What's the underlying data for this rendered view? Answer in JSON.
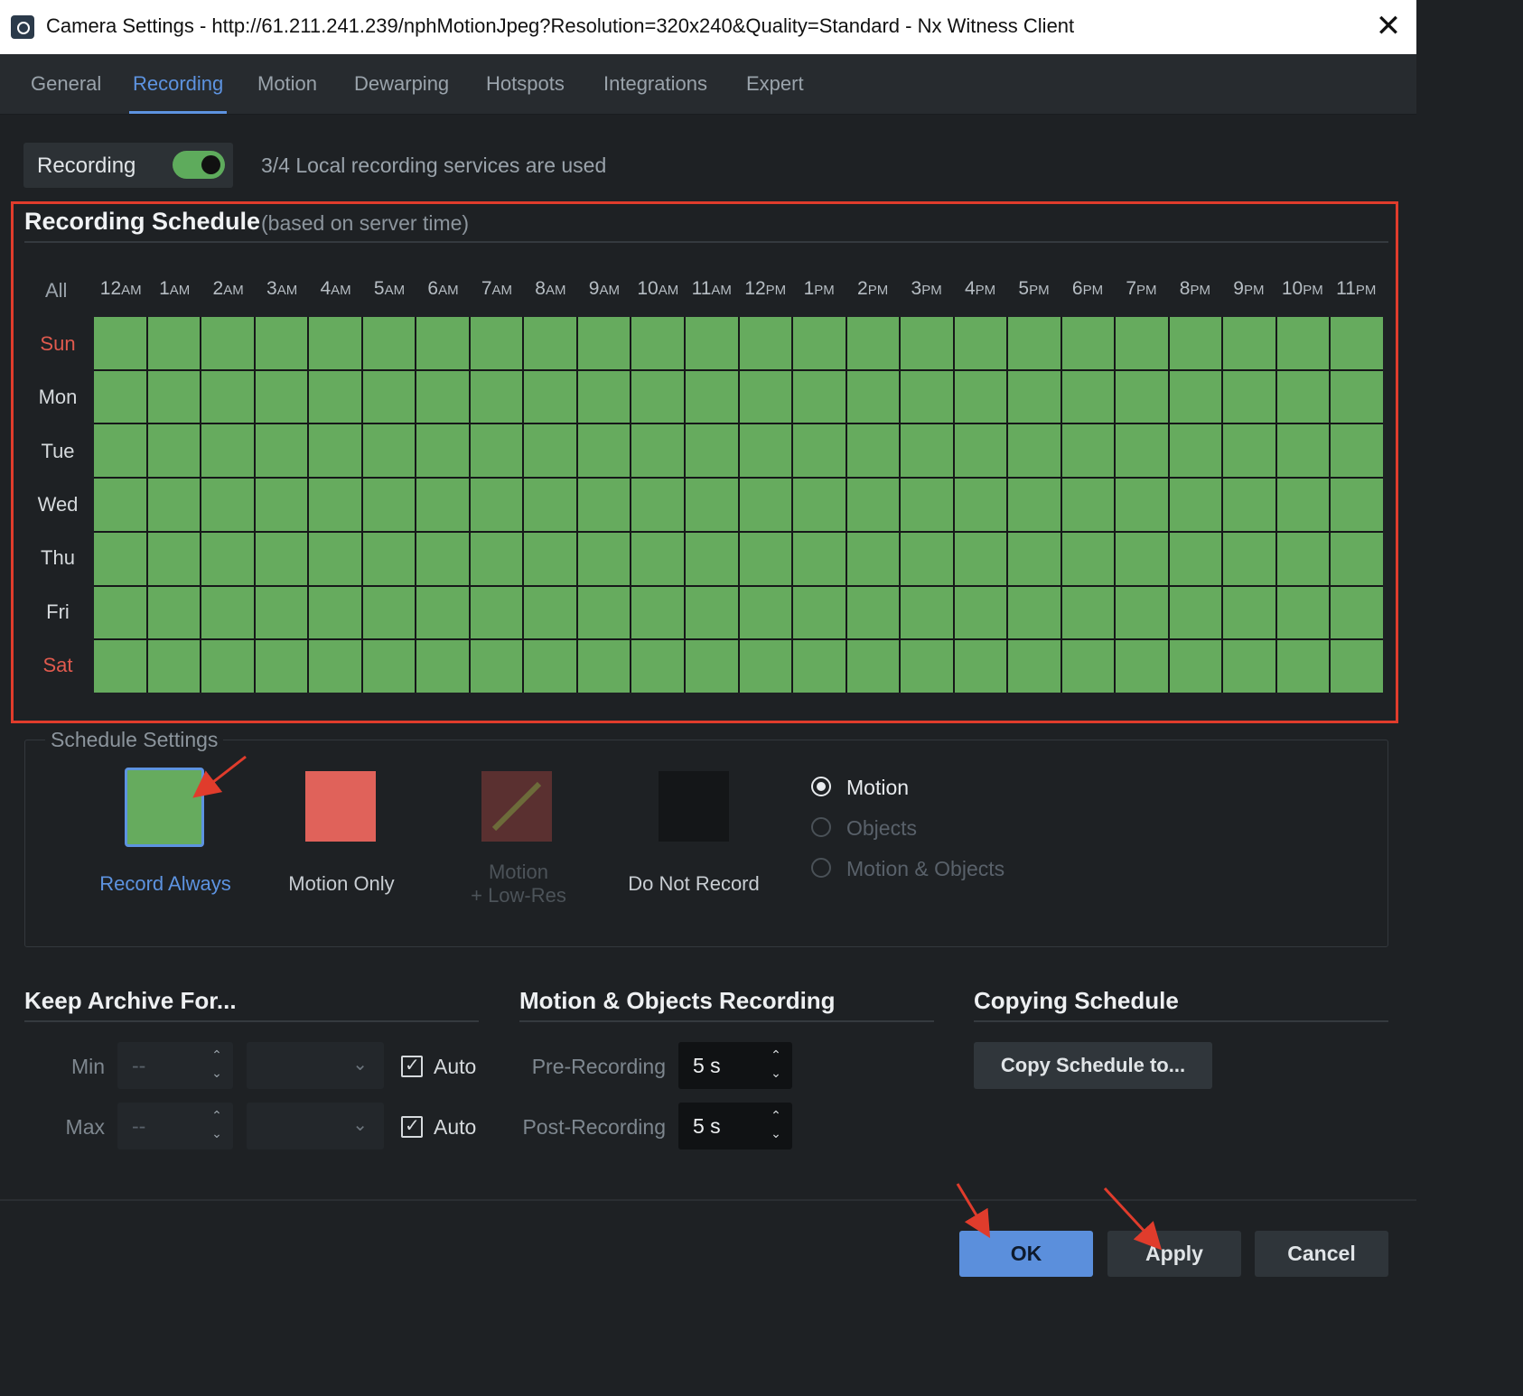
{
  "window": {
    "title": "Camera Settings - http://61.211.241.239/nphMotionJpeg?Resolution=320x240&Quality=Standard - Nx Witness Client",
    "close_glyph": "✕"
  },
  "tabs": [
    {
      "label": "General",
      "active": false
    },
    {
      "label": "Recording",
      "active": true
    },
    {
      "label": "Motion",
      "active": false
    },
    {
      "label": "Dewarping",
      "active": false
    },
    {
      "label": "Hotspots",
      "active": false
    },
    {
      "label": "Integrations",
      "active": false
    },
    {
      "label": "Expert",
      "active": false
    }
  ],
  "recording": {
    "label": "Recording",
    "enabled": true,
    "status": "3/4 Local recording services are used"
  },
  "schedule": {
    "title": "Recording Schedule",
    "subtitle": "(based on server time)",
    "all_label": "All",
    "hours": [
      {
        "n": "12",
        "s": "AM"
      },
      {
        "n": "1",
        "s": "AM"
      },
      {
        "n": "2",
        "s": "AM"
      },
      {
        "n": "3",
        "s": "AM"
      },
      {
        "n": "4",
        "s": "AM"
      },
      {
        "n": "5",
        "s": "AM"
      },
      {
        "n": "6",
        "s": "AM"
      },
      {
        "n": "7",
        "s": "AM"
      },
      {
        "n": "8",
        "s": "AM"
      },
      {
        "n": "9",
        "s": "AM"
      },
      {
        "n": "10",
        "s": "AM"
      },
      {
        "n": "11",
        "s": "AM"
      },
      {
        "n": "12",
        "s": "PM"
      },
      {
        "n": "1",
        "s": "PM"
      },
      {
        "n": "2",
        "s": "PM"
      },
      {
        "n": "3",
        "s": "PM"
      },
      {
        "n": "4",
        "s": "PM"
      },
      {
        "n": "5",
        "s": "PM"
      },
      {
        "n": "6",
        "s": "PM"
      },
      {
        "n": "7",
        "s": "PM"
      },
      {
        "n": "8",
        "s": "PM"
      },
      {
        "n": "9",
        "s": "PM"
      },
      {
        "n": "10",
        "s": "PM"
      },
      {
        "n": "11",
        "s": "PM"
      }
    ],
    "days": [
      {
        "label": "Sun",
        "weekend": true
      },
      {
        "label": "Mon",
        "weekend": false
      },
      {
        "label": "Tue",
        "weekend": false
      },
      {
        "label": "Wed",
        "weekend": false
      },
      {
        "label": "Thu",
        "weekend": false
      },
      {
        "label": "Fri",
        "weekend": false
      },
      {
        "label": "Sat",
        "weekend": true
      }
    ],
    "cell_mode": "record-always"
  },
  "schedule_settings": {
    "title": "Schedule Settings",
    "modes": {
      "record_always": "Record Always",
      "motion_only": "Motion Only",
      "motion_lowres_line1": "Motion",
      "motion_lowres_line2": "+ Low-Res",
      "do_not_record": "Do Not Record"
    },
    "selected_mode": "record_always",
    "trigger": {
      "motion": "Motion",
      "objects": "Objects",
      "motion_objects": "Motion & Objects",
      "selected": "motion"
    }
  },
  "keep_archive": {
    "title": "Keep Archive For...",
    "min_label": "Min",
    "max_label": "Max",
    "min_value": "-- ",
    "max_value": "-- ",
    "auto_label": "Auto",
    "min_auto": true,
    "max_auto": true
  },
  "motion_recording": {
    "title": "Motion & Objects Recording",
    "pre_label": "Pre-Recording",
    "post_label": "Post-Recording",
    "pre_value": "5 s",
    "post_value": "5 s"
  },
  "copying": {
    "title": "Copying Schedule",
    "button": "Copy Schedule to..."
  },
  "footer": {
    "ok": "OK",
    "apply": "Apply",
    "cancel": "Cancel"
  },
  "colors": {
    "record_always": "#66ab5e",
    "motion_only": "#e0625a",
    "motion_lowres": "#5a3030",
    "do_not_record": "#141618",
    "accent": "#5d93e0",
    "annotation": "#e03c2c"
  }
}
